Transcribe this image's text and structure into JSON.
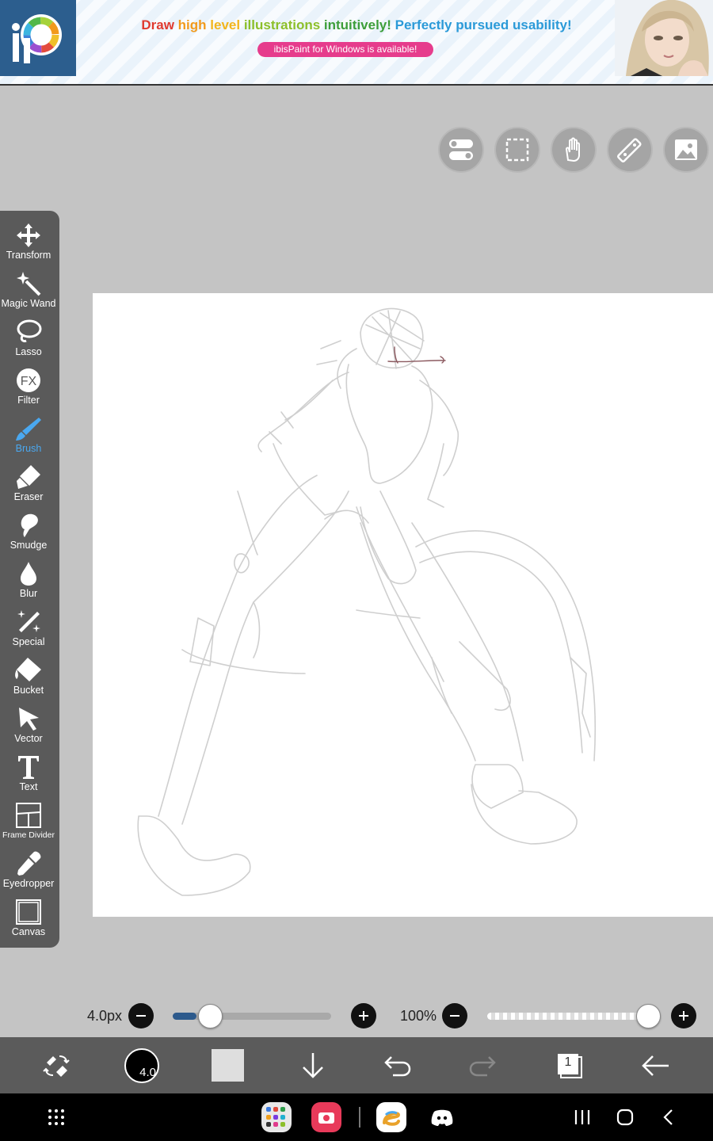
{
  "ad": {
    "headline": [
      {
        "text": "Draw ",
        "color": "#e03a2f"
      },
      {
        "text": "high ",
        "color": "#f29a1c"
      },
      {
        "text": "level ",
        "color": "#f2b51c"
      },
      {
        "text": "illustrations ",
        "color": "#8cbf2a"
      },
      {
        "text": "intuitively! ",
        "color": "#3d9e3a"
      },
      {
        "text": "Perfectly ",
        "color": "#2b9ad8"
      },
      {
        "text": "pursued ",
        "color": "#2b9ad8"
      },
      {
        "text": "usability!",
        "color": "#2b9ad8"
      }
    ],
    "subline": "ibisPaint for Windows is available!",
    "logo_icon": "ibispaint-logo",
    "portrait_icon": "anime-portrait"
  },
  "quick_buttons": [
    {
      "name": "toggle-icon"
    },
    {
      "name": "selection-icon"
    },
    {
      "name": "hand-icon"
    },
    {
      "name": "ruler-icon"
    },
    {
      "name": "reference-image-icon"
    }
  ],
  "toolbar": {
    "tools": [
      {
        "label": "Transform",
        "icon": "move-icon"
      },
      {
        "label": "Magic Wand",
        "icon": "magic-wand-icon"
      },
      {
        "label": "Lasso",
        "icon": "lasso-icon"
      },
      {
        "label": "Filter",
        "icon": "fx-icon"
      },
      {
        "label": "Brush",
        "icon": "brush-icon",
        "active": true
      },
      {
        "label": "Eraser",
        "icon": "eraser-icon"
      },
      {
        "label": "Smudge",
        "icon": "smudge-icon"
      },
      {
        "label": "Blur",
        "icon": "drop-icon"
      },
      {
        "label": "Special",
        "icon": "special-icon"
      },
      {
        "label": "Bucket",
        "icon": "bucket-icon"
      },
      {
        "label": "Vector",
        "icon": "cursor-icon"
      },
      {
        "label": "Text",
        "icon": "text-icon"
      },
      {
        "label": "Frame Divider",
        "icon": "frame-divider-icon"
      },
      {
        "label": "Eyedropper",
        "icon": "eyedropper-icon"
      },
      {
        "label": "Canvas",
        "icon": "canvas-icon"
      }
    ]
  },
  "sliders": {
    "size_label": "4.0px",
    "size_fraction": 0.1,
    "opacity_label": "100%",
    "opacity_fraction": 1.0
  },
  "bottom_bar": {
    "brush_size": "4.0",
    "layer_count": "1",
    "primary_color": "#dedede"
  },
  "colors": {
    "accent": "#4aa8f0",
    "toolbar_bg": "#5a5a5a",
    "workspace_bg": "#c4c4c4"
  }
}
